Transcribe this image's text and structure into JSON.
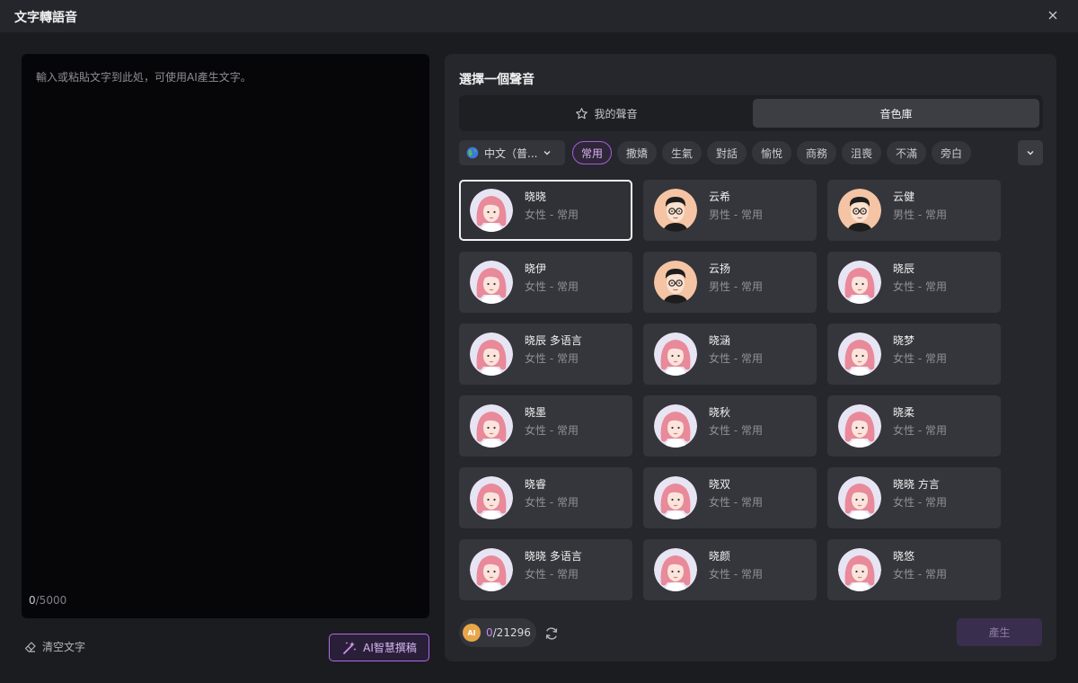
{
  "window": {
    "title": "文字轉語音"
  },
  "editor": {
    "placeholder": "輸入或粘貼文字到此処，可使用AI產生文字。",
    "count_current": "0",
    "count_max": "/5000",
    "clear_label": "清空文字",
    "ai_write_label": "AI智慧撰稿"
  },
  "panel": {
    "title": "選擇一個聲音",
    "tabs": [
      {
        "label": "我的聲音"
      },
      {
        "label": "音色庫"
      }
    ],
    "language": "中文（普...",
    "chips": [
      {
        "label": "常用",
        "active": true
      },
      {
        "label": "撒嬌"
      },
      {
        "label": "生氣"
      },
      {
        "label": "對話"
      },
      {
        "label": "愉悅"
      },
      {
        "label": "商務"
      },
      {
        "label": "沮喪"
      },
      {
        "label": "不滿"
      },
      {
        "label": "旁白"
      }
    ],
    "voices": [
      {
        "name": "晓晓",
        "sub": "女性 - 常用",
        "avatar": "female",
        "selected": true
      },
      {
        "name": "云希",
        "sub": "男性 - 常用",
        "avatar": "male"
      },
      {
        "name": "云健",
        "sub": "男性 - 常用",
        "avatar": "male"
      },
      {
        "name": "晓伊",
        "sub": "女性 - 常用",
        "avatar": "female"
      },
      {
        "name": "云扬",
        "sub": "男性 - 常用",
        "avatar": "male"
      },
      {
        "name": "晓辰",
        "sub": "女性 - 常用",
        "avatar": "female"
      },
      {
        "name": "晓辰 多语言",
        "sub": "女性 - 常用",
        "avatar": "female"
      },
      {
        "name": "晓涵",
        "sub": "女性 - 常用",
        "avatar": "female"
      },
      {
        "name": "晓梦",
        "sub": "女性 - 常用",
        "avatar": "female"
      },
      {
        "name": "晓墨",
        "sub": "女性 - 常用",
        "avatar": "female"
      },
      {
        "name": "晓秋",
        "sub": "女性 - 常用",
        "avatar": "female"
      },
      {
        "name": "晓柔",
        "sub": "女性 - 常用",
        "avatar": "female"
      },
      {
        "name": "晓睿",
        "sub": "女性 - 常用",
        "avatar": "female"
      },
      {
        "name": "晓双",
        "sub": "女性 - 常用",
        "avatar": "female"
      },
      {
        "name": "晓晓 方言",
        "sub": "女性 - 常用",
        "avatar": "female"
      },
      {
        "name": "晓晓 多语言",
        "sub": "女性 - 常用",
        "avatar": "female"
      },
      {
        "name": "晓颜",
        "sub": "女性 - 常用",
        "avatar": "female"
      },
      {
        "name": "晓悠",
        "sub": "女性 - 常用",
        "avatar": "female"
      }
    ],
    "credits": {
      "used": "0",
      "total": "/21296",
      "coin_label": "AI"
    },
    "generate_label": "產生"
  },
  "colors": {
    "accent": "#a35fe0",
    "panel": "#26272c",
    "card": "#35363b"
  },
  "icons": [
    "close-icon",
    "eraser-icon",
    "magic-wand-icon",
    "star-icon",
    "globe-icon",
    "chevron-down-icon",
    "refresh-icon",
    "coin-icon"
  ]
}
